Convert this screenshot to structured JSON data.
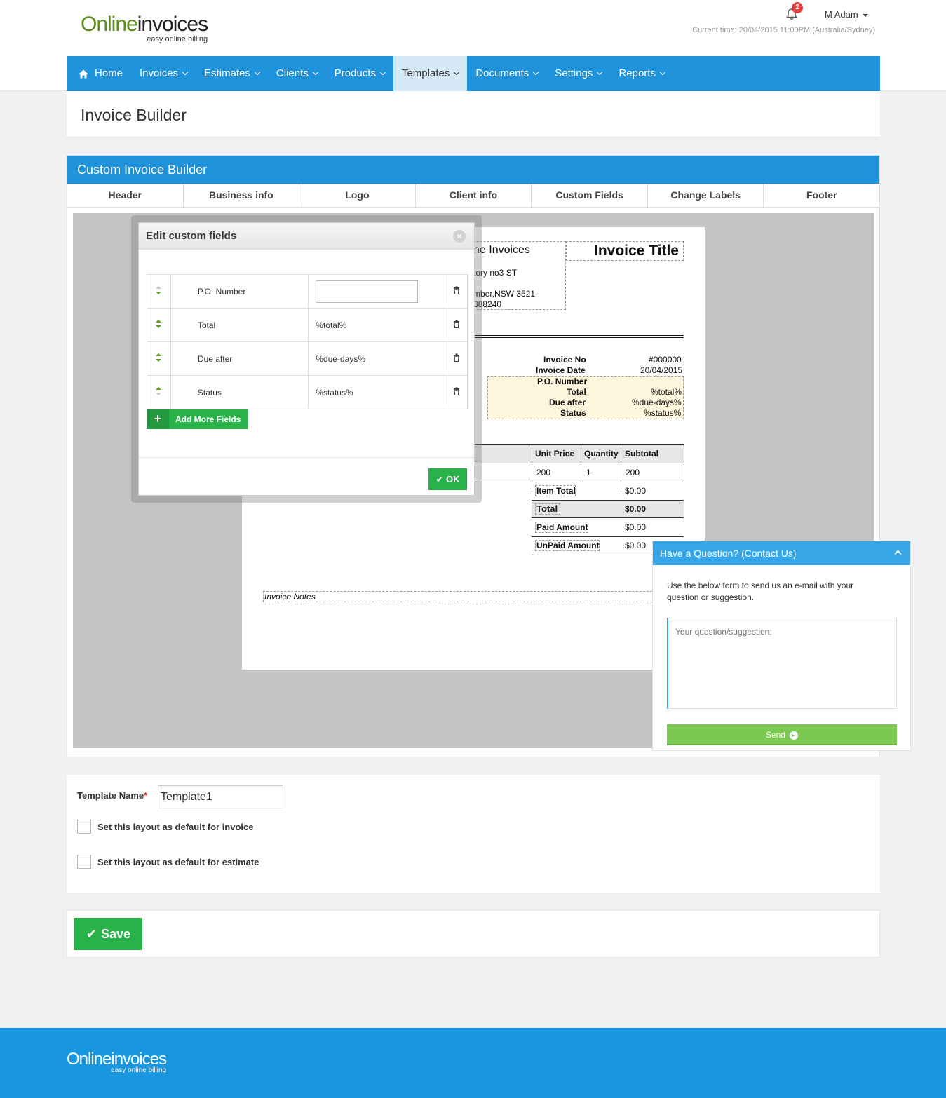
{
  "brand": {
    "logo_part1": "Online",
    "logo_part2": "invoices",
    "tagline": "easy online billing"
  },
  "header": {
    "notification_count": "2",
    "user_name": "M Adam",
    "current_time": "Current time: 20/04/2015 11:00PM (Australia/Sydney)"
  },
  "nav": {
    "items": [
      {
        "label": "Home"
      },
      {
        "label": "Invoices"
      },
      {
        "label": "Estimates"
      },
      {
        "label": "Clients"
      },
      {
        "label": "Products"
      },
      {
        "label": "Templates"
      },
      {
        "label": "Documents"
      },
      {
        "label": "Settings"
      },
      {
        "label": "Reports"
      }
    ],
    "active": "Templates"
  },
  "page_title": "Invoice Builder",
  "builder": {
    "title": "Custom Invoice Builder",
    "tabs": [
      "Header",
      "Business info",
      "Logo",
      "Client info",
      "Custom Fields",
      "Change Labels",
      "Footer"
    ]
  },
  "invoice_preview": {
    "business_name": "ne Invoices",
    "address1": "tory no3 ST",
    "address2": "mber,NSW 3521",
    "phone": "888240",
    "invoice_title": "Invoice Title",
    "meta": [
      {
        "label": "Invoice No",
        "value": "#000000"
      },
      {
        "label": "Invoice Date",
        "value": "20/04/2015"
      }
    ],
    "custom_fields": [
      {
        "label": "P.O. Number",
        "value": ""
      },
      {
        "label": "Total",
        "value": "%total%"
      },
      {
        "label": "Due after",
        "value": "%due-days%"
      },
      {
        "label": "Status",
        "value": "%status%"
      }
    ],
    "items_headers": [
      "Unit Price",
      "Quantity",
      "Subtotal"
    ],
    "item_row": [
      "200",
      "1",
      "200"
    ],
    "totals": [
      {
        "label": "Item Total",
        "value": "$0.00"
      },
      {
        "label": "Total",
        "value": "$0.00"
      },
      {
        "label": "Paid Amount",
        "value": "$0.00"
      },
      {
        "label": "UnPaid Amount",
        "value": "$0.00"
      }
    ],
    "notes_label": "Invoice Notes"
  },
  "modal": {
    "title": "Edit custom fields",
    "close_glyph": "×",
    "fields": [
      {
        "label": "P.O. Number",
        "value": ""
      },
      {
        "label": "Total",
        "value": "%total%"
      },
      {
        "label": "Due after",
        "value": "%due-days%"
      },
      {
        "label": "Status",
        "value": "%status%"
      }
    ],
    "add_label": "Add More Fields",
    "ok_label": "OK"
  },
  "contact": {
    "title": "Have a Question? (Contact Us)",
    "description": "Use the below form to send us an e-mail with your question or suggestion.",
    "placeholder": "Your question/suggestion:",
    "send_label": "Send"
  },
  "template": {
    "name_label": "Template Name",
    "required_mark": "*",
    "name_value": "Template1",
    "default_invoice_label": "Set this layout as default for invoice",
    "default_estimate_label": "Set this layout as default for estimate",
    "default_invoice_checked": false,
    "default_estimate_checked": false
  },
  "save_label": "Save",
  "colors": {
    "nav_blue": "#1e93dc",
    "active_tab": "#d6e9f7",
    "green": "#29b24a",
    "footer_blue": "#1996e0",
    "highlight_yellow": "#fdf5dc"
  }
}
